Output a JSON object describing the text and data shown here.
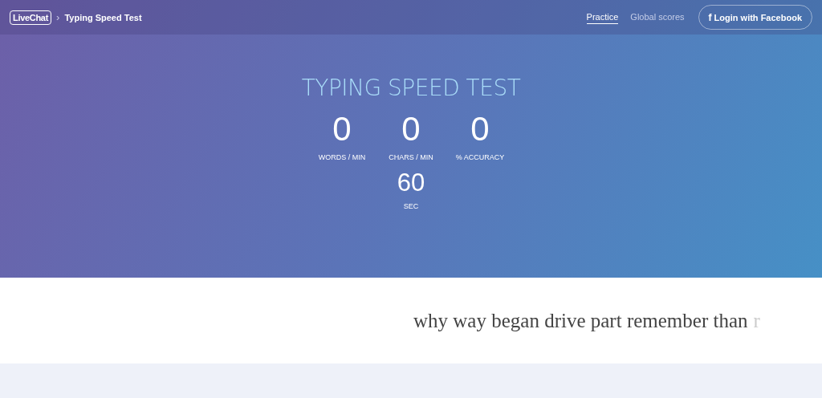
{
  "header": {
    "logo": "LiveChat",
    "separator": "›",
    "title": "Typing Speed Test"
  },
  "nav": [
    {
      "label": "Practice",
      "selected": true
    },
    {
      "label": "Global scores",
      "selected": false
    }
  ],
  "login_button": {
    "icon": "f",
    "label": "Login with Facebook"
  },
  "hero": {
    "title": "TYPING SPEED TEST",
    "stats": [
      {
        "value": "0",
        "label": "WORDS / MIN"
      },
      {
        "value": "0",
        "label": "CHARS / MIN"
      },
      {
        "value": "0",
        "label": "% ACCURACY"
      }
    ],
    "timer": {
      "value": "60",
      "label": "SEC"
    }
  },
  "words": {
    "text": "why way began drive part remember than",
    "next": "r"
  }
}
